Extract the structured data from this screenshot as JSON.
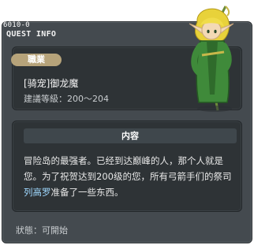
{
  "window": {
    "quest_id": "6010-0",
    "title": "QUEST INFO"
  },
  "job": {
    "tag_label": "職業",
    "name": "[骑宠]御龙魔",
    "level": "建議等級：200～204"
  },
  "description": {
    "header": "内容",
    "text_part1": "冒险岛的最强者。已经到达巅峰的人，那个人就是您。为了祝贺达到200级的您，所有弓箭手们的祭司",
    "highlight_name": "列高罗",
    "text_part2": "准备了一些东西。"
  },
  "status": {
    "text": "狀態：可開始"
  },
  "character": {
    "icon": "elf-archer-character-icon",
    "colors": {
      "hair": "#e8d23a",
      "robe": "#3f8a3a",
      "skin": "#f3d9b5"
    }
  }
}
